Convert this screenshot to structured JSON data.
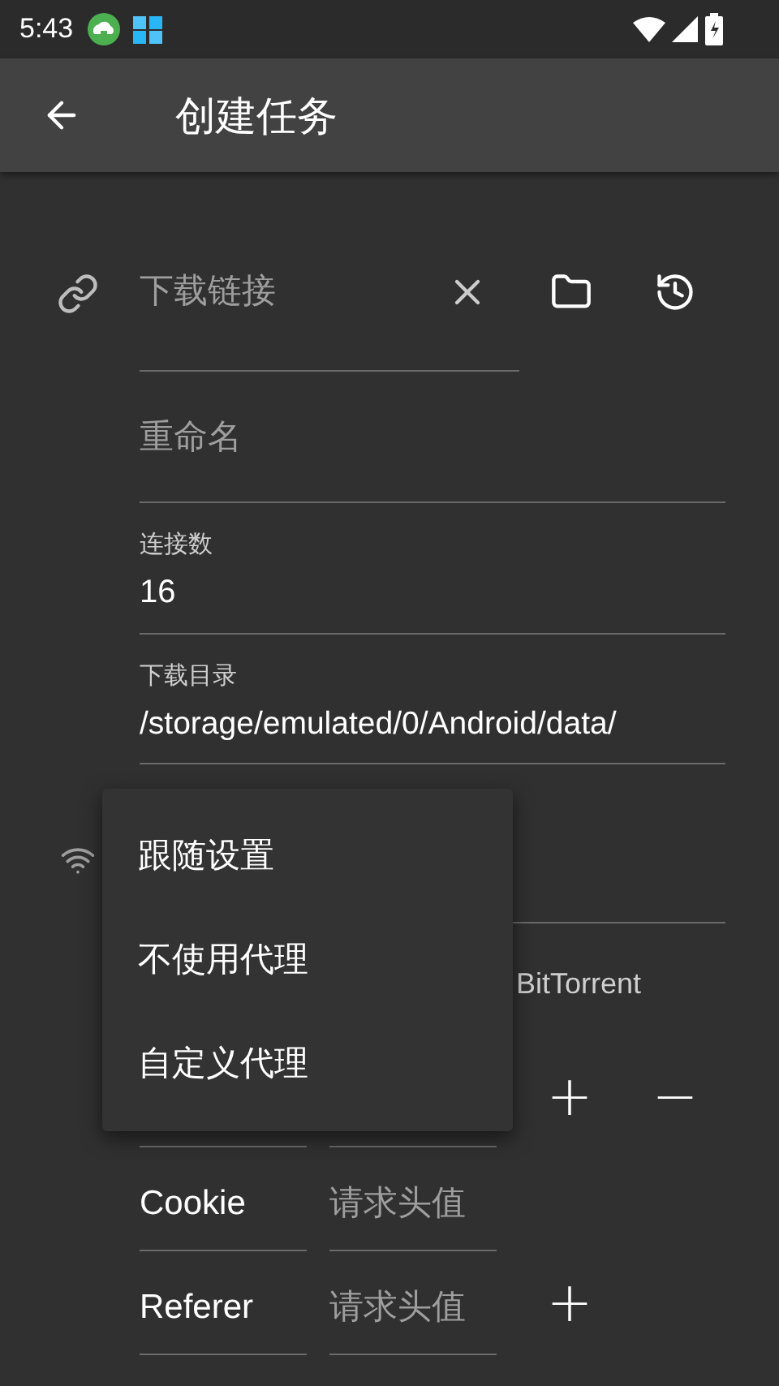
{
  "status_bar": {
    "time": "5:43"
  },
  "app_bar": {
    "title": "创建任务"
  },
  "url_field": {
    "placeholder": "下载链接"
  },
  "rename_field": {
    "placeholder": "重命名"
  },
  "connections": {
    "label": "连接数",
    "value": "16"
  },
  "directory": {
    "label": "下载目录",
    "value": "/storage/emulated/0/Android/data/"
  },
  "tab_label": "BitTorrent",
  "header_rows": [
    {
      "actions": [
        "+",
        "−"
      ]
    },
    {
      "key": "Cookie",
      "placeholder": "请求头值"
    },
    {
      "key": "Referer",
      "placeholder": "请求头值",
      "actions": [
        "+"
      ]
    }
  ],
  "proxy_menu": {
    "items": [
      "跟随设置",
      "不使用代理",
      "自定义代理"
    ]
  }
}
